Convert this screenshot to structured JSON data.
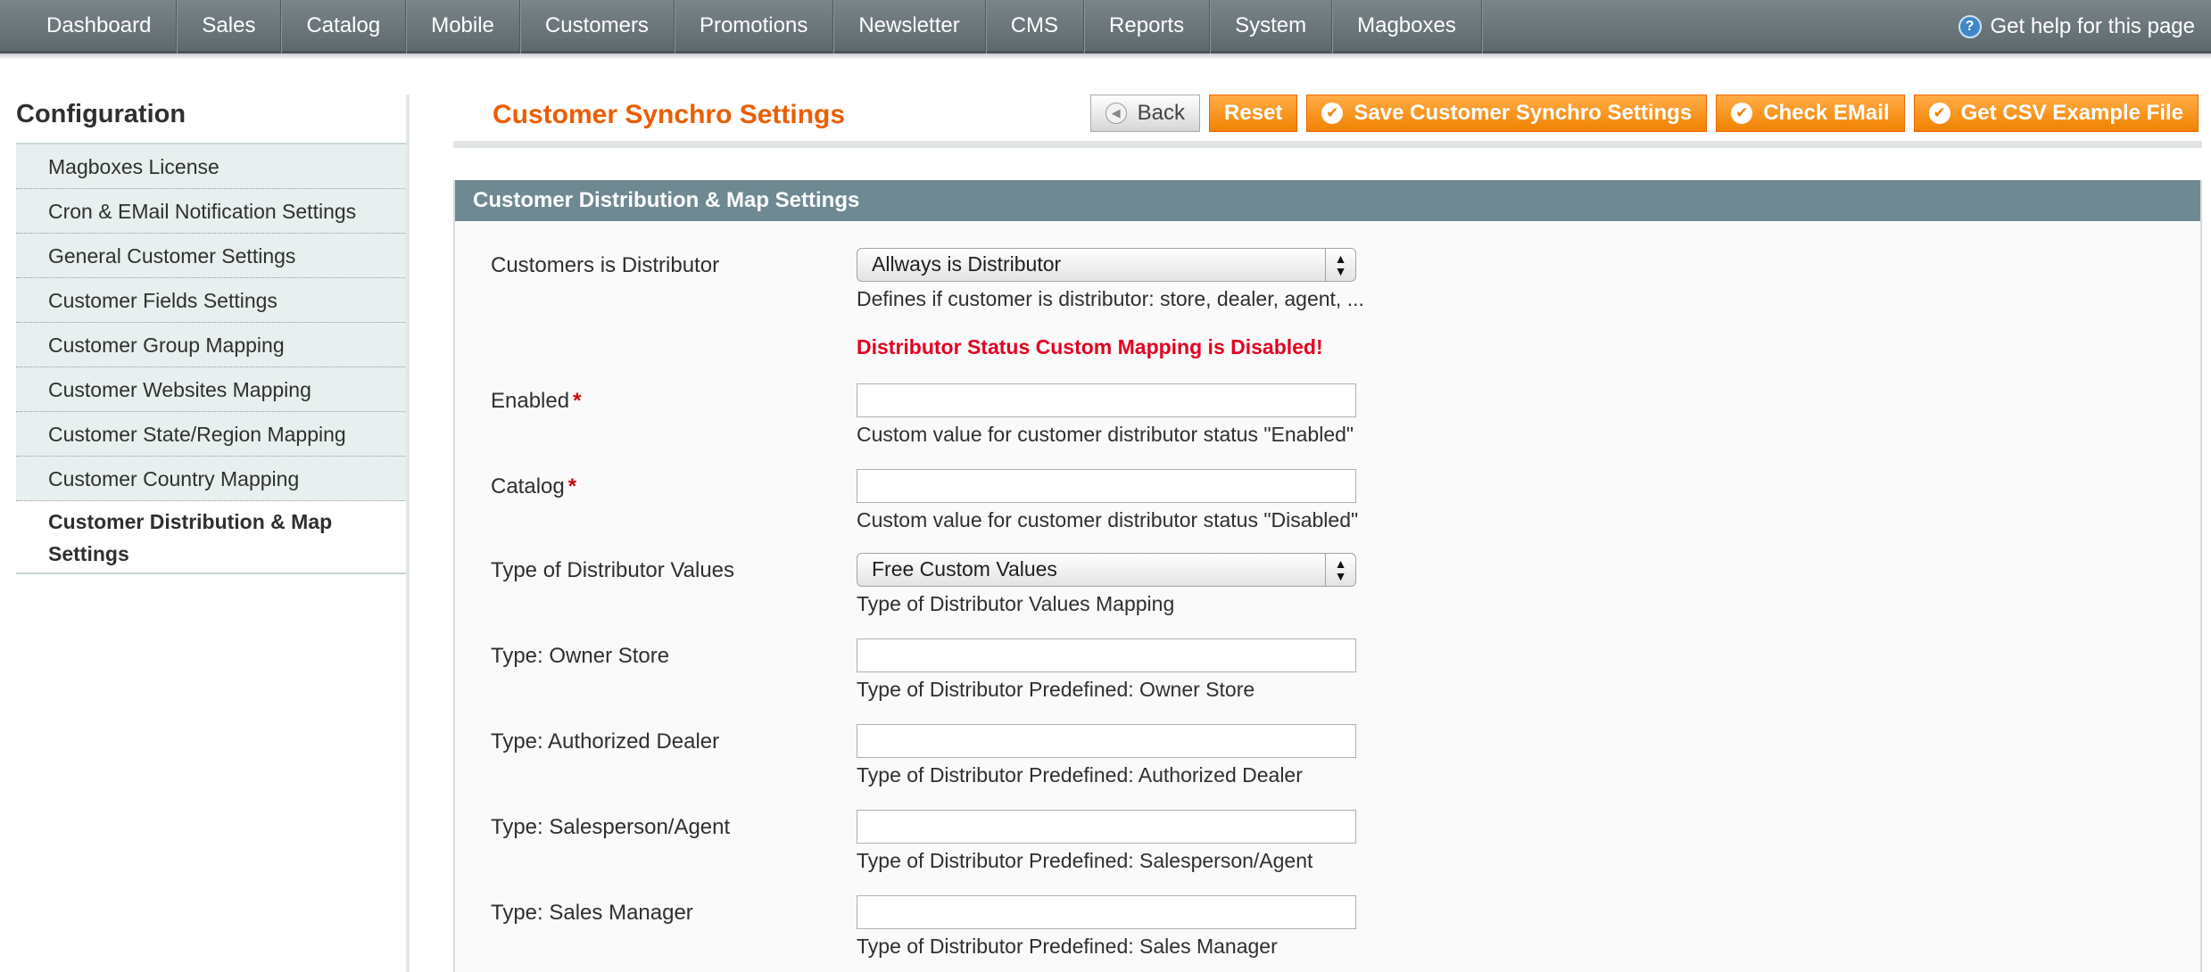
{
  "nav": {
    "items": [
      "Dashboard",
      "Sales",
      "Catalog",
      "Mobile",
      "Customers",
      "Promotions",
      "Newsletter",
      "CMS",
      "Reports",
      "System",
      "Magboxes"
    ],
    "help": "Get help for this page"
  },
  "sidebar": {
    "title": "Configuration",
    "items": [
      "Magboxes License",
      "Cron & EMail Notification Settings",
      "General Customer Settings",
      "Customer Fields Settings",
      "Customer Group Mapping",
      "Customer Websites Mapping",
      "Customer State/Region Mapping",
      "Customer Country Mapping",
      "Customer Distribution & Map Settings"
    ]
  },
  "main": {
    "title": "Customer Synchro Settings",
    "buttons": {
      "back": "Back",
      "reset": "Reset",
      "save": "Save Customer Synchro Settings",
      "check_email": "Check EMail",
      "csv": "Get CSV Example File"
    },
    "section": {
      "title": "Customer Distribution & Map Settings",
      "fields": {
        "distributor": {
          "label": "Customers is Distributor",
          "value": "Allways is Distributor",
          "note": "Defines if customer is distributor: store, dealer, agent, ..."
        },
        "warning": "Distributor Status Custom Mapping is Disabled!",
        "enabled": {
          "label": "Enabled",
          "required": "*",
          "value": "",
          "note": "Custom value for customer distributor status \"Enabled\""
        },
        "catalog": {
          "label": "Catalog",
          "required": "*",
          "value": "",
          "note": "Custom value for customer distributor status \"Disabled\""
        },
        "type_values": {
          "label": "Type of Distributor Values",
          "value": "Free Custom Values",
          "note": "Type of Distributor Values Mapping"
        },
        "owner_store": {
          "label": "Type: Owner Store",
          "value": "",
          "note": "Type of Distributor Predefined: Owner Store"
        },
        "dealer": {
          "label": "Type: Authorized Dealer",
          "value": "",
          "note": "Type of Distributor Predefined: Authorized Dealer"
        },
        "agent": {
          "label": "Type: Salesperson/Agent",
          "value": "",
          "note": "Type of Distributor Predefined: Salesperson/Agent"
        },
        "manager": {
          "label": "Type: Sales Manager",
          "value": "",
          "note": "Type of Distributor Predefined: Sales Manager"
        }
      }
    }
  },
  "colors": {
    "accent": "#eb5e00",
    "button": "#f18200",
    "header": "#6f8992",
    "warning": "#e3001f"
  }
}
